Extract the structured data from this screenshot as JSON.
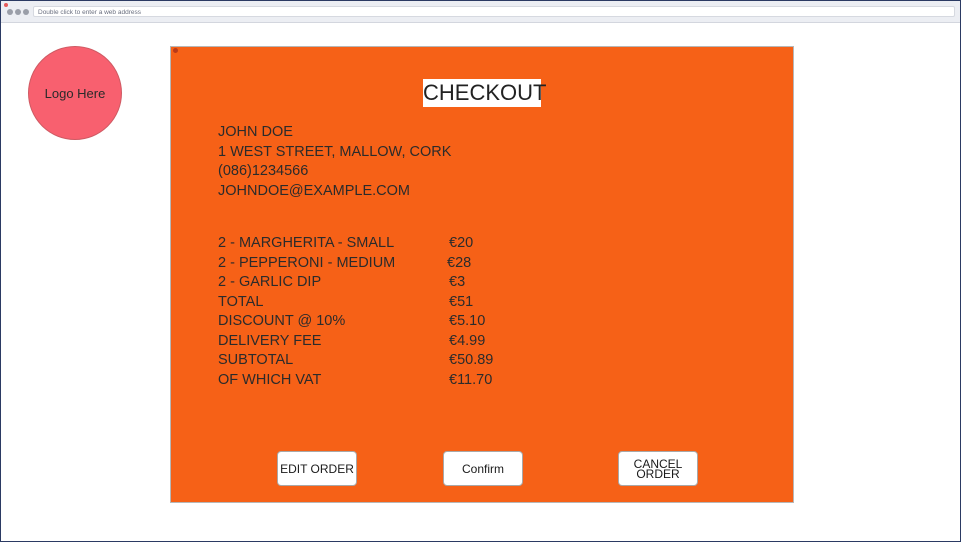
{
  "browser": {
    "address_placeholder": "Double click to enter a web address"
  },
  "logo": {
    "label": "Logo Here"
  },
  "checkout": {
    "title": "CHECKOUT",
    "customer": {
      "name": "JOHN DOE",
      "address": "1 WEST STREET, MALLOW, CORK",
      "phone": "(086)1234566",
      "email": "JOHNDOE@EXAMPLE.COM"
    },
    "order_lines": [
      {
        "label": "2 - MARGHERITA - SMALL",
        "price": "€20"
      },
      {
        "label": "2 - PEPPERONI - MEDIUM",
        "price": "€28"
      },
      {
        "label": "2 - GARLIC DIP",
        "price": "€3"
      },
      {
        "label": "TOTAL",
        "price": "€51"
      },
      {
        "label": "DISCOUNT @ 10%",
        "price": "€5.10"
      },
      {
        "label": "DELIVERY FEE",
        "price": "€4.99"
      },
      {
        "label": "SUBTOTAL",
        "price": "€50.89"
      },
      {
        "label": "OF WHICH VAT",
        "price": "€11.70"
      }
    ],
    "buttons": {
      "edit_label": "EDIT ORDER",
      "confirm_label": "Confirm",
      "cancel_label": "CANCEL ORDER"
    }
  },
  "colors": {
    "panel": "#f66117",
    "logo": "#f8606f",
    "title_box": "#ffffff"
  }
}
